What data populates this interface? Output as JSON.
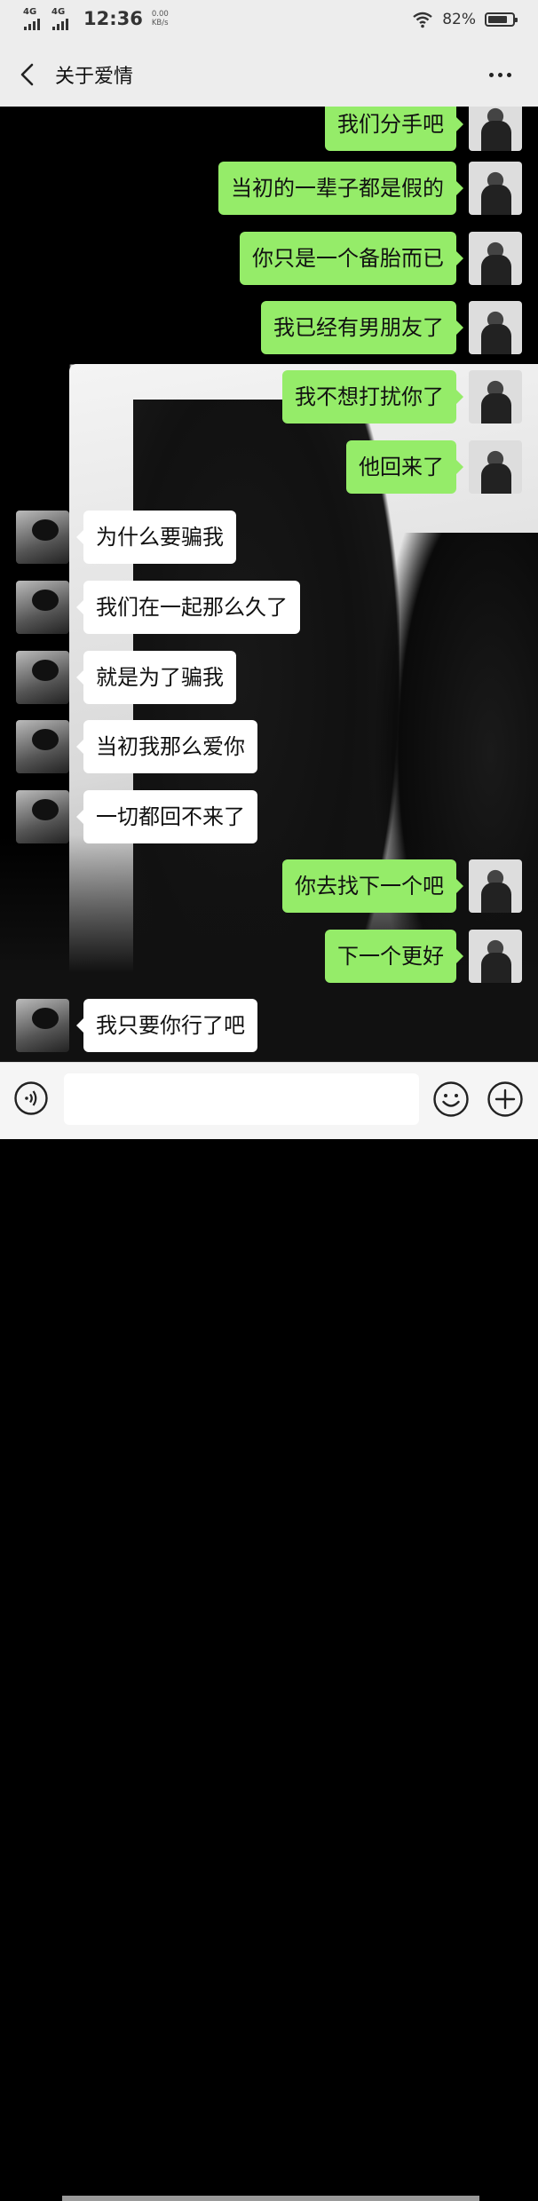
{
  "status_bar": {
    "signal1_label": "4G",
    "signal2_label": "4G",
    "time": "12:36",
    "net_speed_value": "0.00",
    "net_speed_unit": "KB/s",
    "battery_percent": "82%",
    "battery_level": 0.82
  },
  "header": {
    "title": "关于爱情"
  },
  "messages": [
    {
      "side": "right",
      "text": "我们分手吧"
    },
    {
      "side": "right",
      "text": "当初的一辈子都是假的"
    },
    {
      "side": "right",
      "text": "你只是一个备胎而已"
    },
    {
      "side": "right",
      "text": "我已经有男朋友了"
    },
    {
      "side": "right",
      "text": "我不想打扰你了"
    },
    {
      "side": "right",
      "text": "他回来了"
    },
    {
      "side": "left",
      "text": "为什么要骗我"
    },
    {
      "side": "left",
      "text": "我们在一起那么久了"
    },
    {
      "side": "left",
      "text": "就是为了骗我"
    },
    {
      "side": "left",
      "text": "当初我那么爱你"
    },
    {
      "side": "left",
      "text": "一切都回不来了"
    },
    {
      "side": "right",
      "text": "你去找下一个吧"
    },
    {
      "side": "right",
      "text": "下一个更好"
    },
    {
      "side": "left",
      "text": "我只要你行了吧"
    }
  ],
  "input": {
    "value": "",
    "placeholder": ""
  },
  "colors": {
    "sent_bubble": "#95ec69",
    "received_bubble": "#ffffff",
    "bar_background": "#ededed"
  }
}
